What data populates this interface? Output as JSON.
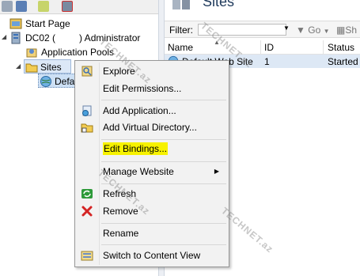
{
  "tree": {
    "start_page": "Start Page",
    "server": "DC02 (         ) Administrator",
    "app_pools": "Application Pools",
    "sites": "Sites",
    "default_site_partial": "Defa"
  },
  "content": {
    "title": "Sites",
    "filter_label": "Filter:",
    "go_label": "Go",
    "show_label": "Sh",
    "columns": [
      "Name",
      "ID",
      "Status"
    ],
    "rows": [
      {
        "name": "Default Web Site",
        "id": "1",
        "status": "Started"
      }
    ]
  },
  "context_menu": {
    "items": [
      {
        "label": "Explore",
        "icon": "explore-icon"
      },
      {
        "label": "Edit Permissions..."
      },
      {
        "label": "Add Application...",
        "icon": "add-application-icon"
      },
      {
        "label": "Add Virtual Directory...",
        "icon": "add-virtual-directory-icon"
      },
      {
        "label": "Edit Bindings...",
        "highlighted": true
      },
      {
        "label": "Manage Website",
        "submenu": true
      },
      {
        "label": "Refresh",
        "icon": "refresh-icon"
      },
      {
        "label": "Remove",
        "icon": "remove-icon"
      },
      {
        "label": "Rename"
      },
      {
        "label": "Switch to Content View",
        "icon": "content-view-icon"
      }
    ]
  },
  "watermark": "TECHNET.az",
  "colors": {
    "highlight": "#f7f200",
    "selected_row": "#dde8f5",
    "remove_red": "#d42424",
    "refresh_green": "#2e9a3a"
  }
}
